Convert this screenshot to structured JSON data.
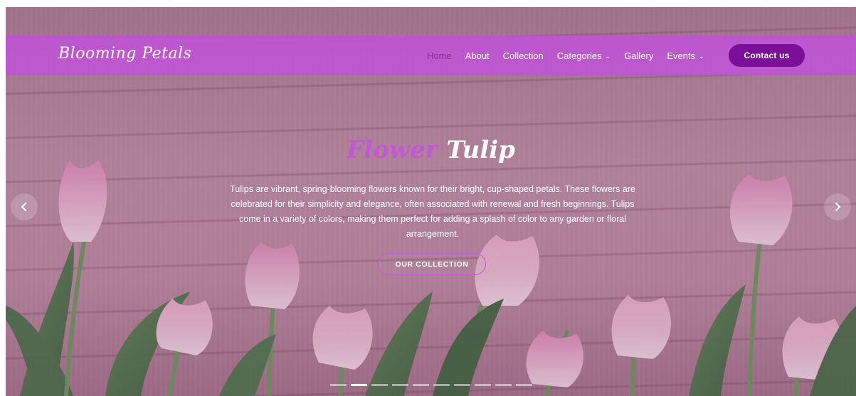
{
  "brand": {
    "name": "Blooming Petals"
  },
  "nav": {
    "items": [
      {
        "label": "Home",
        "active": true
      },
      {
        "label": "About"
      },
      {
        "label": "Collection"
      },
      {
        "label": "Categories",
        "dropdown": true
      },
      {
        "label": "Gallery"
      },
      {
        "label": "Events",
        "dropdown": true
      }
    ],
    "contact_label": "Contact us"
  },
  "hero": {
    "title_part1": "Flower",
    "title_part2": "Tulip",
    "description": "Tulips are vibrant, spring-blooming flowers known for their bright, cup-shaped petals. These flowers are celebrated for their simplicity and elegance, often associated with renewal and fresh beginnings. Tulips come in a variety of colors, making them perfect for adding a splash of color to any garden or floral arrangement.",
    "cta_label": "OUR COLLECTION",
    "prev_icon": "chevron-left-icon",
    "next_icon": "chevron-right-icon"
  },
  "carousel": {
    "slide_count": 10,
    "active_index": 1
  },
  "colors": {
    "nav_bg": "#be55d2",
    "accent": "#c257d6",
    "active_link": "#8b2e97",
    "contact_bg": "#7c0f98"
  }
}
